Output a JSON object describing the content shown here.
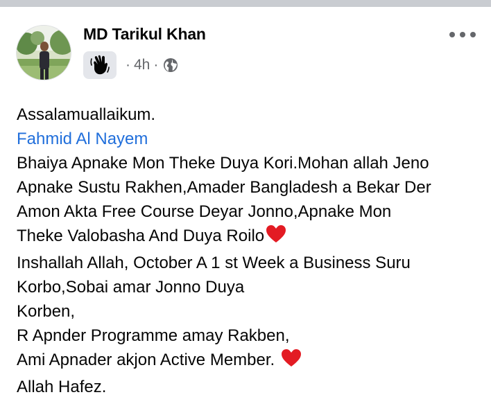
{
  "post": {
    "author_name": "MD Tarikul Khan",
    "timestamp": "4h",
    "separator": "·",
    "audience_icon": "globe-icon",
    "badge_icon": "waving-hand-icon",
    "more_icon": "more-options-icon",
    "greeting": "Assalamuallaikum.",
    "mention": "Fahmid Al Nayem",
    "body_lines": [
      "Bhaiya Apnake Mon Theke Duya Kori.Mohan allah Jeno",
      "Apnake Sustu Rakhen,Amader Bangladesh a Bekar Der",
      "Amon Akta Free Course Deyar Jonno,Apnake Mon",
      "Theke Valobasha And Duya Roilo",
      "Inshallah Allah, October A 1 st Week a Business Suru",
      "Korbo,Sobai amar Jonno Duya",
      "Korben,",
      "R Apnder Programme amay Rakben,",
      "Ami Apnader akjon Active Member. ",
      "Allah Hafez."
    ],
    "heart_icon": "red-heart-icon",
    "colors": {
      "mention": "#216fdb",
      "secondary_text": "#65676b",
      "heart": "#e31b23",
      "divider": "#c9ccd1"
    }
  }
}
